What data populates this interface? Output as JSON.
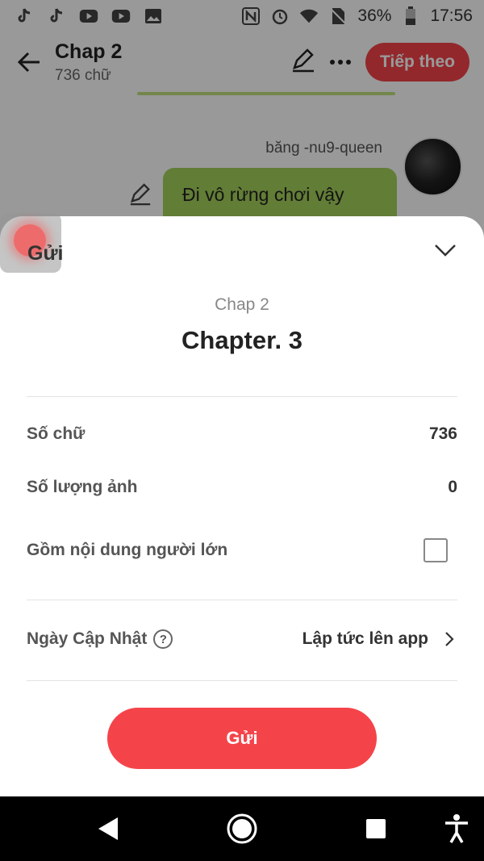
{
  "status_bar": {
    "battery": "36%",
    "time": "17:56",
    "icons": [
      "tiktok-icon",
      "tiktok-icon",
      "youtube-icon",
      "youtube-icon",
      "image-icon",
      "nfc-icon",
      "alarm-icon",
      "wifi-icon",
      "no-sim-icon",
      "battery-icon"
    ]
  },
  "header": {
    "title": "Chap 2",
    "subtitle": "736 chữ",
    "next_label": "Tiếp theo"
  },
  "chat": {
    "username": "băng -nu9-queen",
    "message": "Đi vô rừng chơi vậy"
  },
  "sheet": {
    "label": "Gửi",
    "chapter_name": "Chap 2",
    "chapter_title": "Chapter. 3",
    "rows": [
      {
        "label": "Số chữ",
        "value": "736"
      },
      {
        "label": "Số lượng ảnh",
        "value": "0"
      },
      {
        "label": "Gồm nội dung người lớn",
        "checked": false
      }
    ],
    "update": {
      "label": "Ngày Cập Nhật",
      "help": "?",
      "value": "Lập tức lên app"
    },
    "submit_label": "Gửi"
  },
  "colors": {
    "accent": "#f4444a",
    "bubble": "#a4d05a"
  }
}
